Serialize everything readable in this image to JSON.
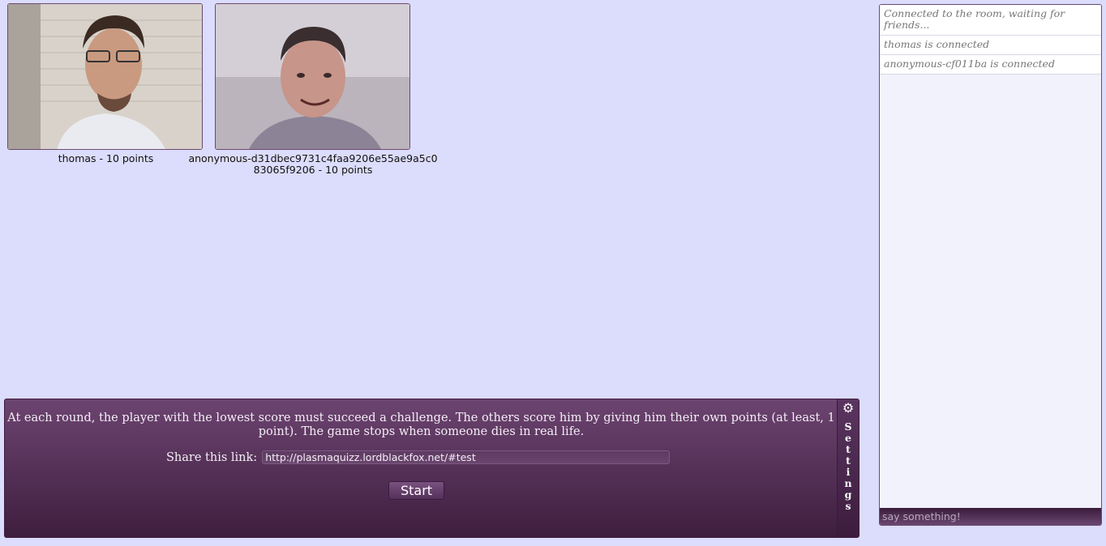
{
  "players": [
    {
      "caption": "thomas - 10 points"
    },
    {
      "caption": "anonymous-d31dbec9731c4faa9206e55ae9a5c083065f9206 - 10 points"
    }
  ],
  "game": {
    "rules": "At each round, the player with the lowest score must succeed a challenge. The others score him by giving him their own points (at least, 1 point). The game stops when someone dies in real life.",
    "share_label": "Share this link:",
    "share_url": "http://plasmaquizz.lordblackfox.net/#test",
    "start_label": "Start",
    "settings_label": "Settings",
    "settings_icon": "gear-icon"
  },
  "chat": {
    "messages": [
      "Connected to the room, waiting for friends...",
      "thomas is connected",
      "anonymous-cf011ba is connected"
    ],
    "input_placeholder": "say something!"
  },
  "colors": {
    "background": "#dcdcfc",
    "panel": "#5a3560",
    "chat_bg": "#f2f2fc"
  }
}
